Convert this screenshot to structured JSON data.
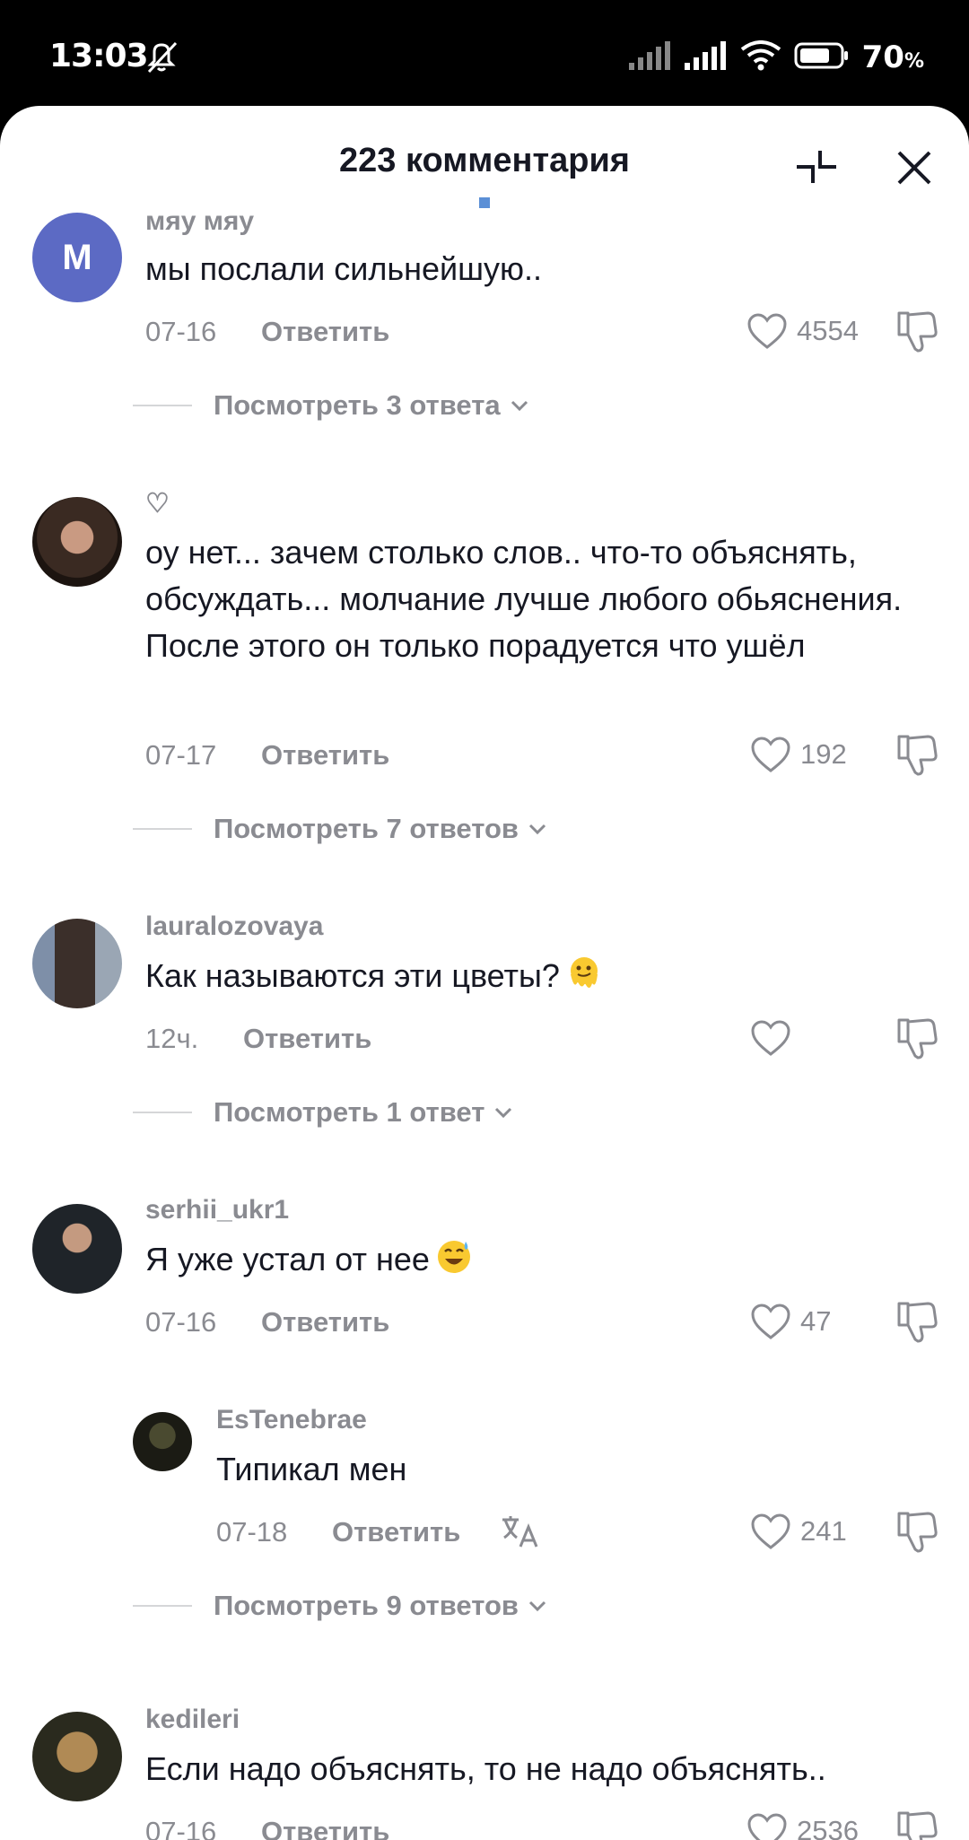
{
  "status_bar": {
    "time": "13:03",
    "battery": "70",
    "battery_unit": "%"
  },
  "sheet": {
    "title": "223 комментария"
  },
  "comments": [
    {
      "username": "мяу мяу",
      "avatar_letter": "М",
      "text": "мы послали сильнейшую..",
      "date": "07-16",
      "reply_label": "Ответить",
      "likes": "4554",
      "view_replies": "Посмотреть 3 ответа"
    },
    {
      "username": "♡",
      "text": "оу нет... зачем столько слов.. что-то объяснять, обсуждать... молчание лучше любого обьяснения. После этого он только порадуется что ушёл",
      "date": "07-17",
      "reply_label": "Ответить",
      "likes": "192",
      "view_replies": "Посмотреть 7 ответов"
    },
    {
      "username": "lauralozovaya",
      "text": "Как называются эти цветы?",
      "emoji": "melting-face",
      "date": "12ч.",
      "reply_label": "Ответить",
      "likes": "",
      "view_replies": "Посмотреть 1 ответ"
    },
    {
      "username": "serhii_ukr1",
      "text": "Я уже устал от нее",
      "emoji": "grinning-sweat",
      "date": "07-16",
      "reply_label": "Ответить",
      "likes": "47"
    },
    {
      "username": "EsTenebrae",
      "text": "Типикал мен",
      "date": "07-18",
      "reply_label": "Ответить",
      "likes": "241",
      "view_replies": "Посмотреть 9 ответов",
      "is_reply": true
    },
    {
      "username": "kedileri",
      "text": "Если надо объяснять, то не надо объяснять..",
      "date": "07-16",
      "reply_label": "Ответить",
      "likes": "2536"
    }
  ],
  "colors": {
    "accent_avatar": "#5c6ac4",
    "muted": "#8a8b91",
    "text": "#161823"
  }
}
